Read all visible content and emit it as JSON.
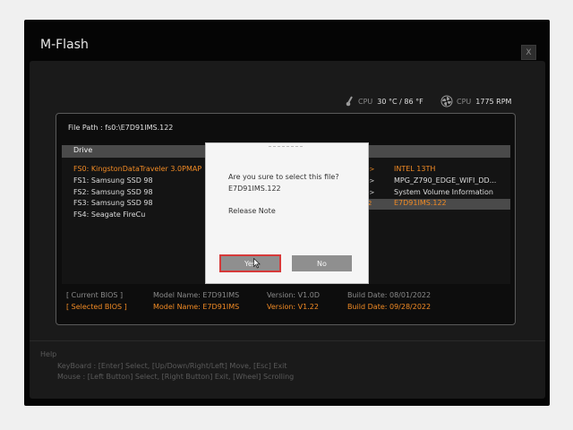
{
  "app": {
    "title": "M-Flash",
    "close_label": "X"
  },
  "status": {
    "cpu_temp_label": "CPU",
    "cpu_temp_value": "30 °C / 86 °F",
    "cpu_fan_label": "CPU",
    "cpu_fan_value": "1775 RPM"
  },
  "file_path": "File Path : fs0:\\E7D91IMS.122",
  "list": {
    "header": "Drive",
    "drives": [
      "FS0: KingstonDataTraveler 3.0PMAP",
      "FS1: Samsung SSD 98",
      "FS2: Samsung SSD 98",
      "FS3: Samsung SSD 98",
      "FS4: Seagate FireCu"
    ],
    "files": [
      {
        "name": "INTEL 13TH",
        "arrow": "->"
      },
      {
        "name": "MPG_Z790_EDGE_WIFI_DD...",
        "arrow": "->"
      },
      {
        "name": "System Volume Information",
        "arrow": "->"
      },
      {
        "name": "E7D91IMS.122",
        "size": "432"
      }
    ]
  },
  "bios": {
    "current": {
      "label": "[ Current BIOS ]",
      "model": "Model Name: E7D91IMS",
      "version": "Version: V1.0D",
      "build": "Build Date: 08/01/2022"
    },
    "selected": {
      "label": "[ Selected BIOS ]",
      "model": "Model Name: E7D91IMS",
      "version": "Version: V1.22",
      "build": "Build Date: 09/28/2022"
    }
  },
  "dialog": {
    "question": "Are you sure to select this file?",
    "filename": "E7D91IMS.122",
    "release_note": "Release Note",
    "yes_label": "Yes",
    "no_label": "No"
  },
  "help": {
    "title": "Help",
    "keyboard": "KeyBoard :  [Enter]  Select,   [Up/Down/Right/Left]  Move,   [Esc]  Exit",
    "mouse": "Mouse     :  [Left Button]  Select,   [Right Button]  Exit,   [Wheel]  Scrolling"
  },
  "colors": {
    "accent": "#f08a24",
    "selection_border": "#d63a3a",
    "background": "#050505"
  }
}
